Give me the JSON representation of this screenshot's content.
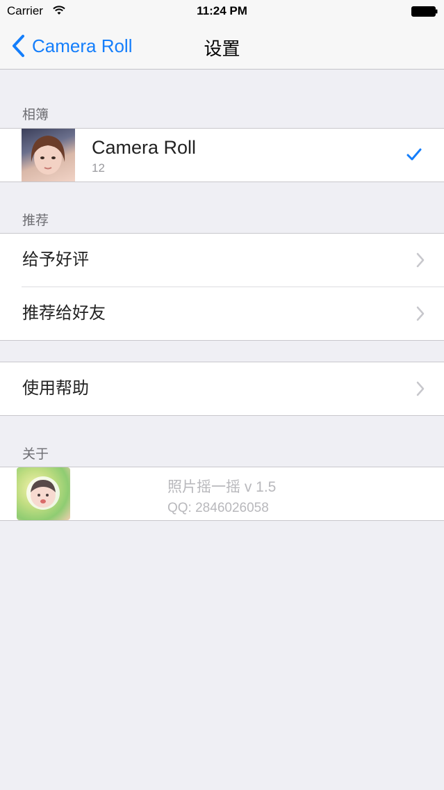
{
  "status": {
    "carrier": "Carrier",
    "time": "11:24 PM"
  },
  "nav": {
    "back_label": "Camera Roll",
    "title": "设置"
  },
  "albums": {
    "header": "相簿",
    "items": [
      {
        "name": "Camera Roll",
        "count": "12",
        "selected": true
      }
    ]
  },
  "recommend": {
    "header": "推荐",
    "items": [
      {
        "label": "给予好评"
      },
      {
        "label": "推荐给好友"
      }
    ]
  },
  "help": {
    "items": [
      {
        "label": "使用帮助"
      }
    ]
  },
  "about": {
    "header": "关于",
    "app_title": "照片摇一摇 v 1.5",
    "qq": "QQ: 2846026058"
  },
  "colors": {
    "accent": "#147efb",
    "background": "#efeff4",
    "section_text": "#6d6d72"
  }
}
